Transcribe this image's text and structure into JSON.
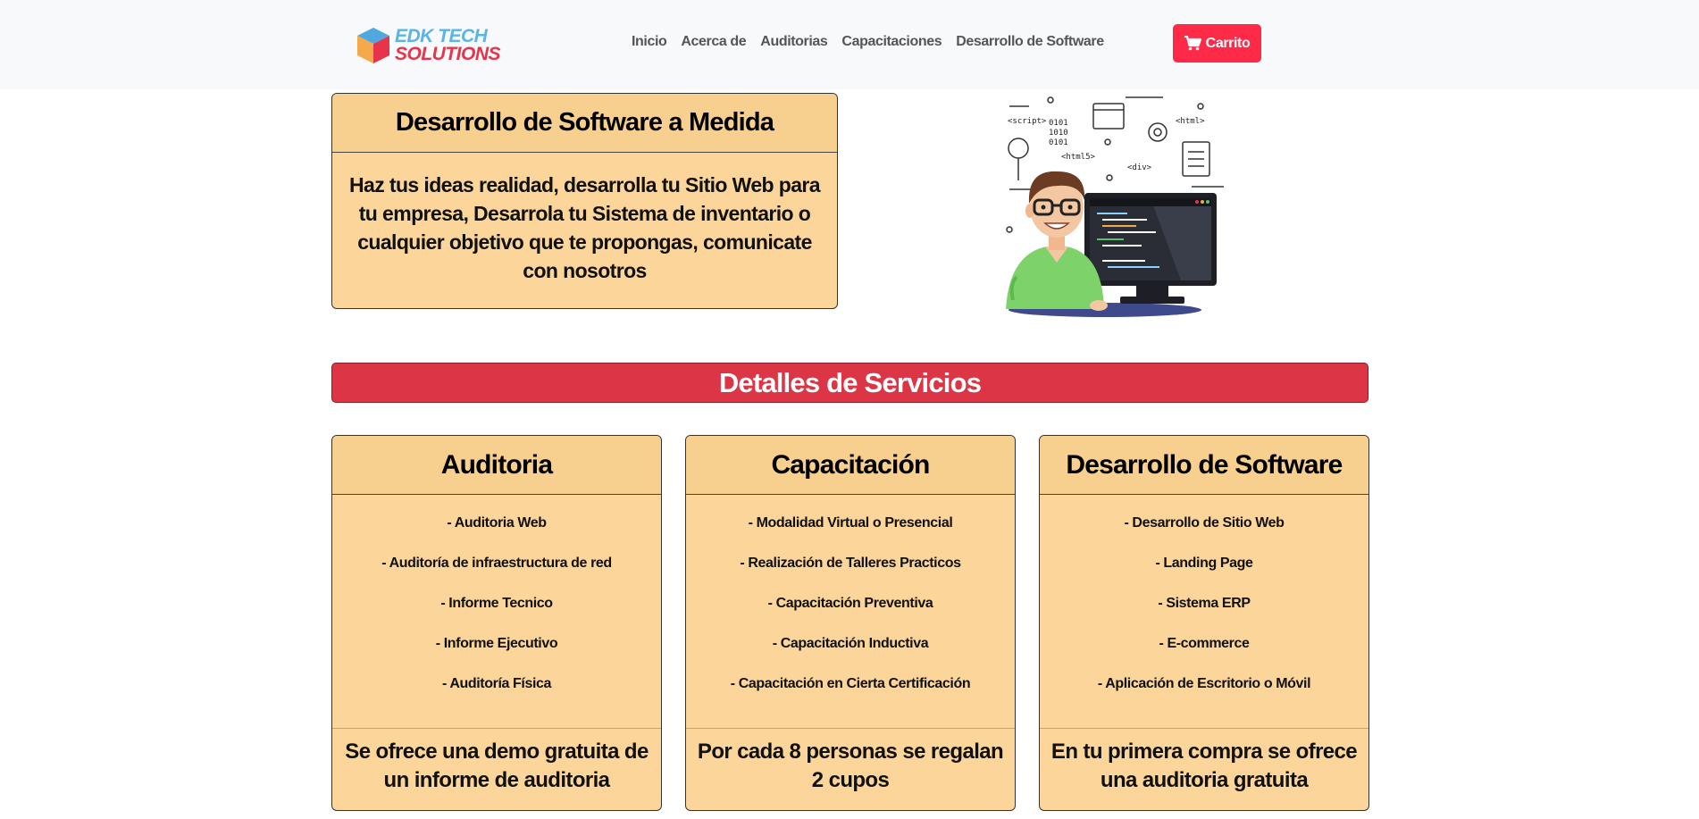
{
  "brand": {
    "line1": "EDK TECH",
    "line2": "SOLUTIONS"
  },
  "nav": {
    "links": [
      "Inicio",
      "Acerca de",
      "Auditorias",
      "Capacitaciones",
      "Desarrollo de Software"
    ],
    "cart_label": "Carrito"
  },
  "hero": {
    "title": "Desarrollo de Software a Medida",
    "body": "Haz tus ideas realidad, desarrolla tu Sitio Web para tu empresa, Desarrola tu Sistema de inventario o cualquier objetivo que te propongas, comunicate con nosotros"
  },
  "illustration": {
    "tags": [
      "<script>",
      "<html>",
      "<html5>",
      "<div>",
      "0101",
      "1010",
      "0101"
    ]
  },
  "section_title": "Detalles de Servicios",
  "services": [
    {
      "title": "Auditoria",
      "items": [
        "- Auditoria Web",
        "- Auditoría de infraestructura de red",
        "- Informe Tecnico",
        "- Informe Ejecutivo",
        "- Auditoría Física"
      ],
      "footer": "Se ofrece una demo gratuita de un informe de auditoria"
    },
    {
      "title": "Capacitación",
      "items": [
        "- Modalidad Virtual o Presencial",
        "- Realización de Talleres Practicos",
        "- Capacitación Preventiva",
        "- Capacitación Inductiva",
        "- Capacitación en Cierta Certificación"
      ],
      "footer": "Por cada 8 personas se regalan 2 cupos"
    },
    {
      "title": "Desarrollo de Software",
      "items": [
        "- Desarrollo de Sitio Web",
        "- Landing Page",
        "- Sistema ERP",
        "- E-commerce",
        "- Aplicación de Escritorio o Móvil"
      ],
      "footer": "En tu primera compra se ofrece una auditoria gratuita"
    }
  ],
  "colors": {
    "accent": "#dc3545",
    "cart": "#ff2a47",
    "card_bg": "#fcd59a",
    "navbar_bg": "#f8f9fa"
  }
}
